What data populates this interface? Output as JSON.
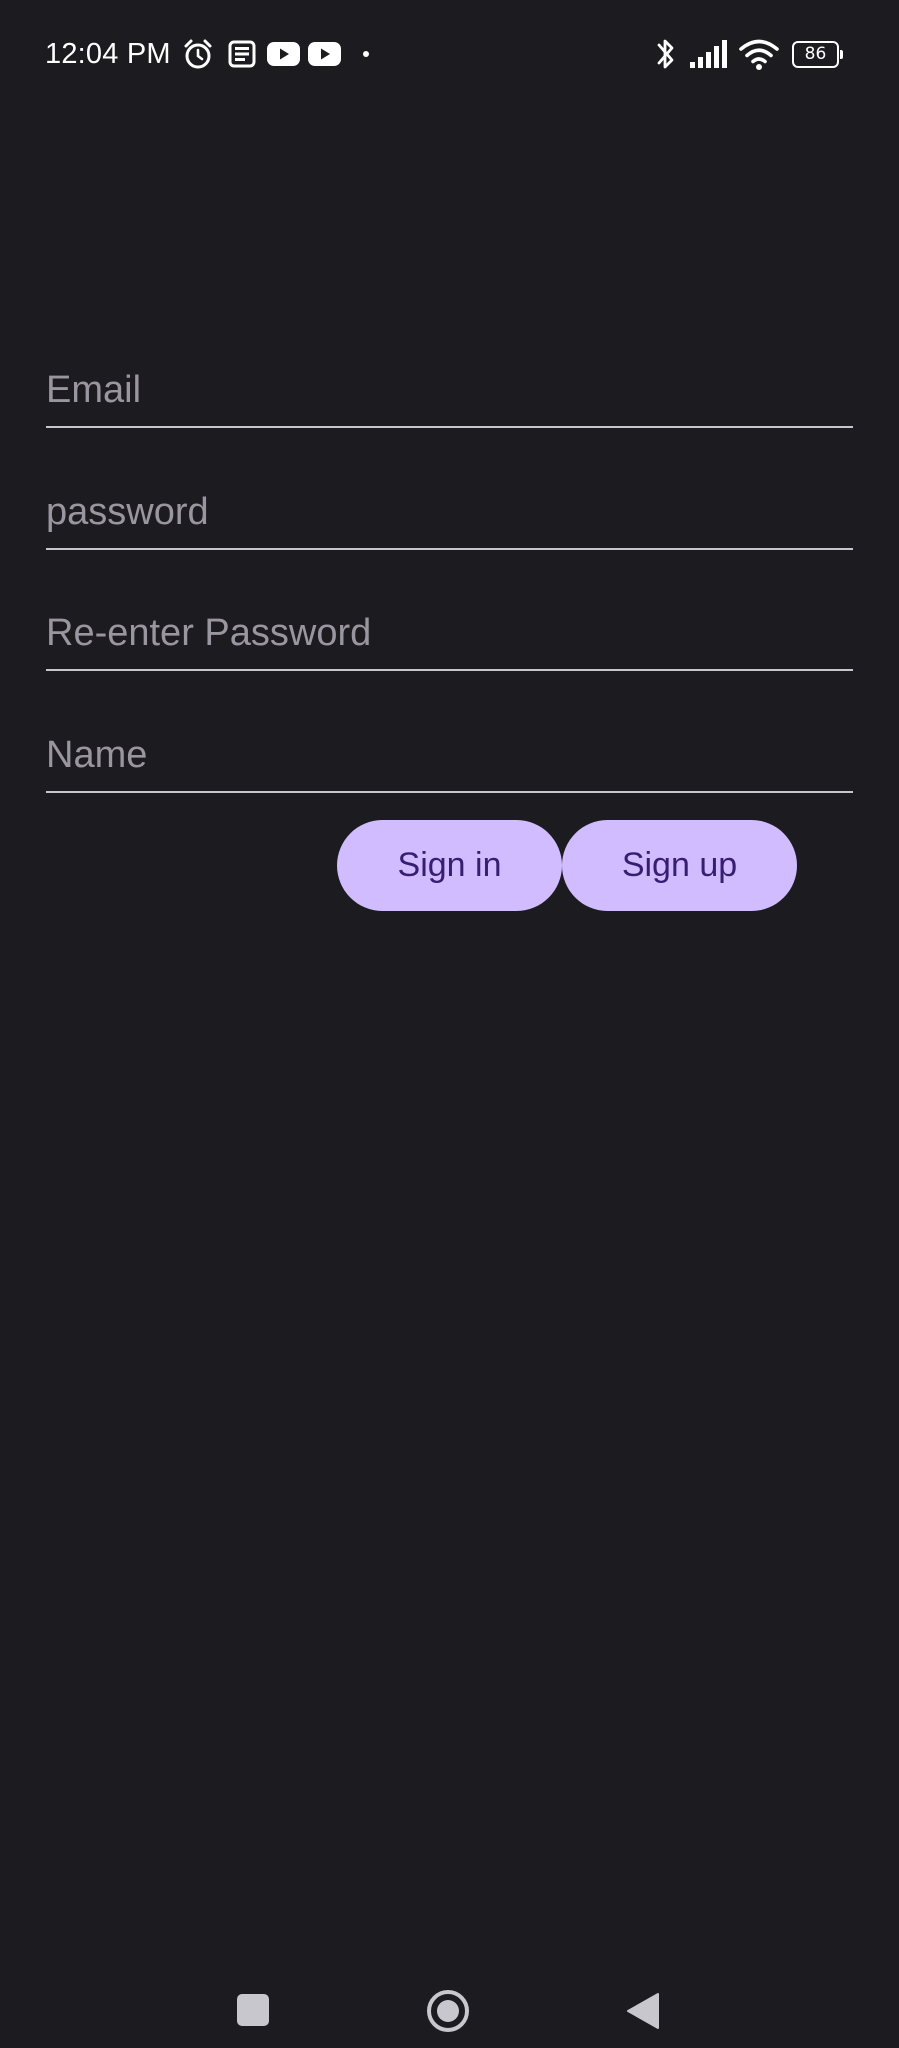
{
  "status_bar": {
    "time": "12:04 PM",
    "battery_level": "86",
    "left_icons": [
      "alarm-icon",
      "news-icon",
      "youtube-icon",
      "youtube-icon",
      "dot-icon"
    ],
    "right_icons": [
      "bluetooth-icon",
      "signal-icon",
      "wifi-icon",
      "battery-icon"
    ]
  },
  "form": {
    "email_placeholder": "Email",
    "email_value": "",
    "password_placeholder": "password",
    "password_value": "",
    "reenter_password_placeholder": "Re-enter Password",
    "reenter_password_value": "",
    "name_placeholder": "Name",
    "name_value": ""
  },
  "buttons": {
    "sign_in_label": "Sign in",
    "sign_up_label": "Sign up"
  },
  "nav_bar": {
    "icons": [
      "recents-square-icon",
      "home-circle-icon",
      "back-triangle-icon"
    ]
  },
  "colors": {
    "background": "#1c1b20",
    "button_fill": "#d0bcff",
    "button_text": "#381e72",
    "placeholder": "#9a969f",
    "underline": "#c9c5cf"
  }
}
